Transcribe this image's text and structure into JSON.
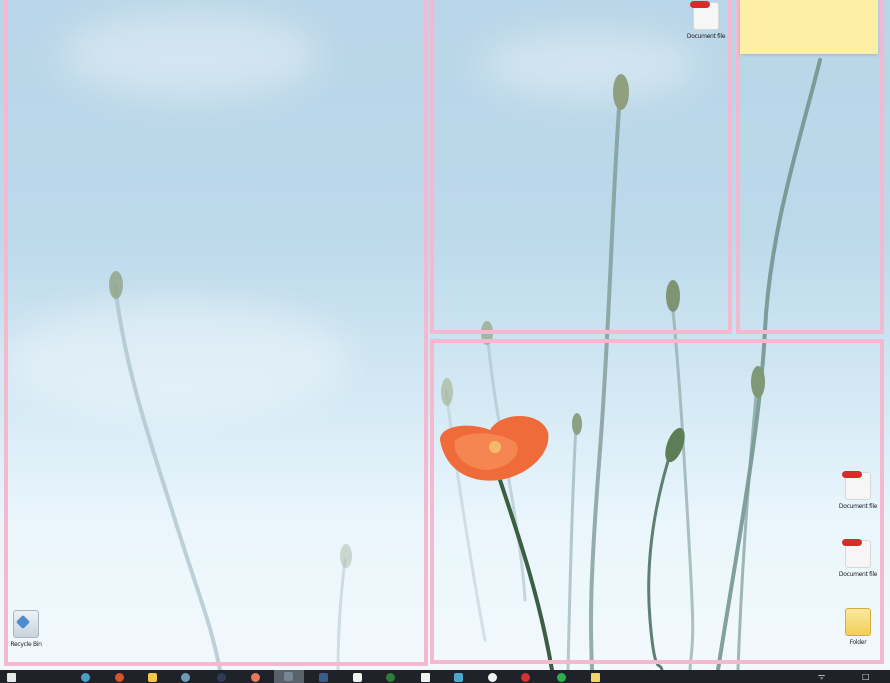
{
  "desktop": {
    "snap_zones": [
      {
        "name": "left-zone"
      },
      {
        "name": "top-middle-zone"
      },
      {
        "name": "top-right-zone"
      },
      {
        "name": "bottom-right-zone"
      }
    ],
    "icons": [
      {
        "id": "recycle-bin",
        "icon": "recycle-bin-icon",
        "label": "Recycle Bin"
      },
      {
        "id": "top-file",
        "icon": "file-icon",
        "label": "Document file"
      },
      {
        "id": "right-file-1",
        "icon": "file-icon",
        "label": "Document file"
      },
      {
        "id": "right-file-2",
        "icon": "file-icon",
        "label": "Document file"
      },
      {
        "id": "right-folder",
        "icon": "folder-icon",
        "label": "Folder"
      }
    ],
    "sticky_note": {
      "text": ""
    }
  },
  "taskbar": {
    "items": [
      {
        "name": "start-icon",
        "color": "#e9e9e9"
      },
      {
        "name": "search-icon",
        "color": "#2d333b"
      },
      {
        "name": "edge-icon",
        "color": "#4a9fc9"
      },
      {
        "name": "browser-icon",
        "color": "#d9542b"
      },
      {
        "name": "file-explorer-icon",
        "color": "#f3c64b"
      },
      {
        "name": "settings-icon",
        "color": "#6e9ab9"
      },
      {
        "name": "terminal-icon",
        "color": "#2f3c57"
      },
      {
        "name": "paint-icon",
        "color": "#e9775d"
      },
      {
        "name": "active-app-icon",
        "color": "#7a8693"
      },
      {
        "name": "photos-icon",
        "color": "#3b5c86"
      },
      {
        "name": "notepad-icon",
        "color": "#f3f3f3"
      },
      {
        "name": "xbox-icon",
        "color": "#2f7d3a"
      },
      {
        "name": "calendar-icon",
        "color": "#f3f3f3"
      },
      {
        "name": "store-icon",
        "color": "#4ea6c9"
      },
      {
        "name": "cloud-icon",
        "color": "#f3f3f3"
      },
      {
        "name": "media-icon",
        "color": "#d23232"
      },
      {
        "name": "spotify-icon",
        "color": "#2cb04d"
      },
      {
        "name": "sticky-notes-icon",
        "color": "#f2d56a"
      }
    ],
    "tray": {
      "wifi_label": "ᯤ",
      "notification_label": "□"
    }
  }
}
